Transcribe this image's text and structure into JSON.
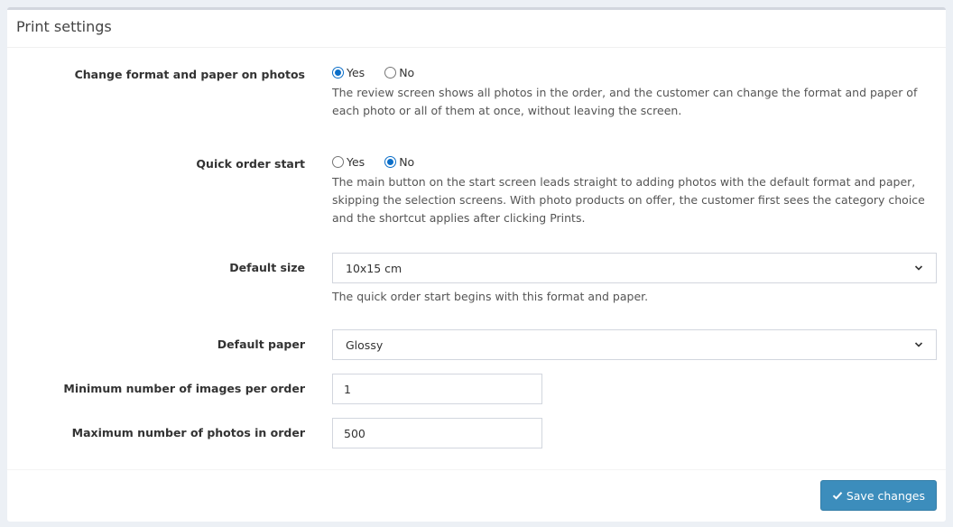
{
  "panel": {
    "title": "Print settings"
  },
  "fields": {
    "change_format": {
      "label": "Change format and paper on photos",
      "options": [
        "Yes",
        "No"
      ],
      "selected": "Yes",
      "help": "The review screen shows all photos in the order, and the customer can change the format and paper of each photo or all of them at once, without leaving the screen."
    },
    "quick_order": {
      "label": "Quick order start",
      "options": [
        "Yes",
        "No"
      ],
      "selected": "No",
      "help": "The main button on the start screen leads straight to adding photos with the default format and paper, skipping the selection screens. With photo products on offer, the customer first sees the category choice and the shortcut applies after clicking Prints."
    },
    "default_size": {
      "label": "Default size",
      "value": "10x15 cm",
      "help": "The quick order start begins with this format and paper."
    },
    "default_paper": {
      "label": "Default paper",
      "value": "Glossy"
    },
    "min_images": {
      "label": "Minimum number of images per order",
      "value": "1"
    },
    "max_photos": {
      "label": "Maximum number of photos in order",
      "value": "500"
    }
  },
  "footer": {
    "save_label": "Save changes"
  },
  "colors": {
    "accent": "#3c8dbc",
    "radio": "#0b6ec8"
  }
}
